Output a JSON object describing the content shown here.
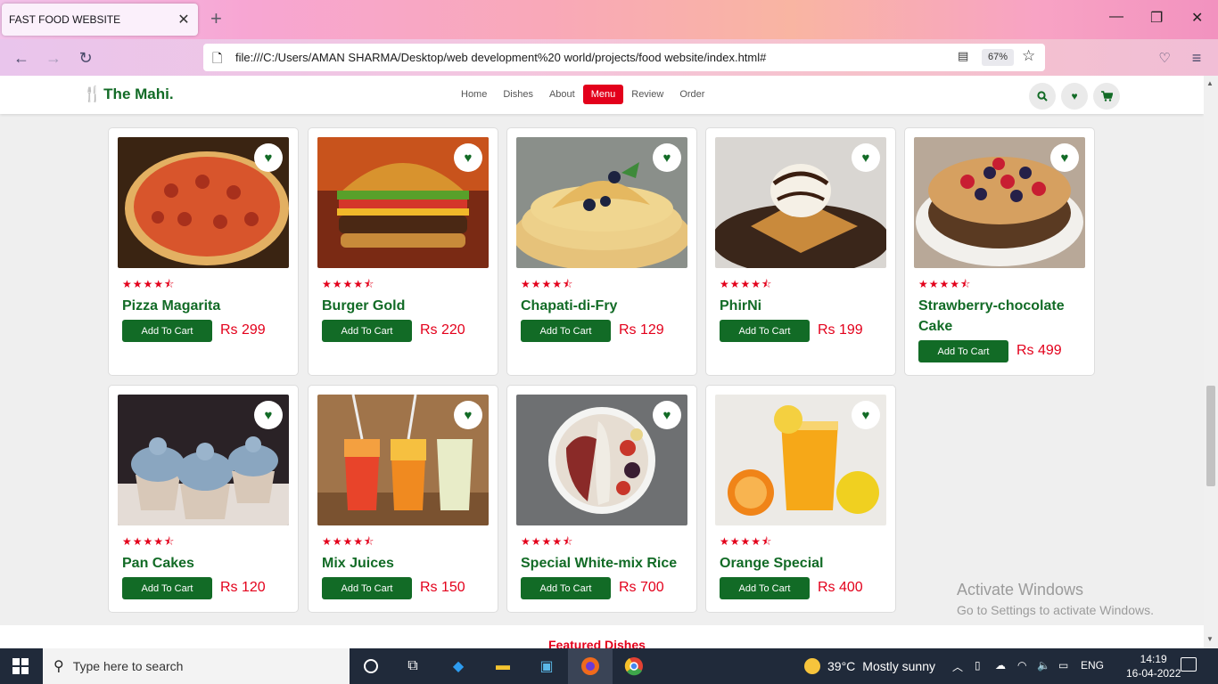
{
  "browser": {
    "tab_title": "FAST FOOD WEBSITE",
    "tab_close": "✕",
    "new_tab": "+",
    "url": "file:///C:/Users/AMAN SHARMA/Desktop/web development%20 world/projects/food website/index.html#",
    "zoom": "67%"
  },
  "site": {
    "logo_text": "The Mahi.",
    "menu": [
      {
        "label": "Home",
        "active": false
      },
      {
        "label": "Dishes",
        "active": false
      },
      {
        "label": "About",
        "active": false
      },
      {
        "label": "Menu",
        "active": true
      },
      {
        "label": "Review",
        "active": false
      },
      {
        "label": "Order",
        "active": false
      }
    ]
  },
  "menu_items": [
    {
      "name": "Pizza Magarita",
      "price": "Rs 299",
      "rating": 4.5,
      "image": "pizza"
    },
    {
      "name": "Burger Gold",
      "price": "Rs 220",
      "rating": 4.5,
      "image": "burger"
    },
    {
      "name": "Chapati-di-Fry",
      "price": "Rs 129",
      "rating": 4.5,
      "image": "crepes"
    },
    {
      "name": "PhirNi",
      "price": "Rs 199",
      "rating": 4.5,
      "image": "waffle"
    },
    {
      "name": "Strawberry-chocolate Cake",
      "price": "Rs 499",
      "rating": 4.5,
      "image": "cake"
    },
    {
      "name": "Pan Cakes",
      "price": "Rs 120",
      "rating": 4.5,
      "image": "cupcakes"
    },
    {
      "name": "Mix Juices",
      "price": "Rs 150",
      "rating": 4.5,
      "image": "juices"
    },
    {
      "name": "Special White-mix Rice",
      "price": "Rs 700",
      "rating": 4.5,
      "image": "bowl"
    },
    {
      "name": "Orange Special",
      "price": "Rs 400",
      "rating": 4.5,
      "image": "orange"
    }
  ],
  "cart_button_label": "Add To Cart",
  "stars_text": "★★★★⯪",
  "activate": {
    "line1": "Activate Windows",
    "line2": "Go to Settings to activate Windows."
  },
  "partial_section_title": "Featured Dishes",
  "taskbar": {
    "search_placeholder": "Type here to search",
    "weather_temp": "39°C",
    "weather_text": "Mostly sunny",
    "language": "ENG",
    "time": "14:19",
    "date": "16-04-2022"
  },
  "colors": {
    "brand_green": "#126b26",
    "brand_red": "#e3001b"
  }
}
